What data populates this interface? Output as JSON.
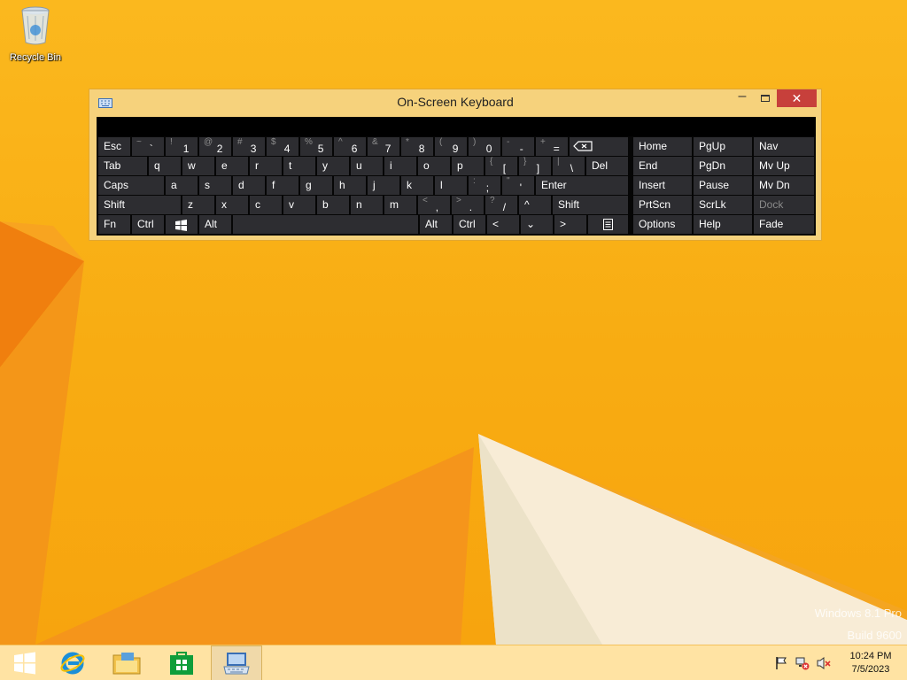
{
  "desktop": {
    "recycle_bin_label": "Recycle Bin",
    "watermark_line1": "Windows 8.1 Pro",
    "watermark_line2": "Build 9600"
  },
  "window": {
    "title": "On-Screen Keyboard",
    "minimize_glyph": "‒",
    "close_glyph": "✕"
  },
  "keys": {
    "esc": "Esc",
    "tilde": {
      "shift": "~",
      "base": "`"
    },
    "n1": {
      "shift": "!",
      "base": "1"
    },
    "n2": {
      "shift": "@",
      "base": "2"
    },
    "n3": {
      "shift": "#",
      "base": "3"
    },
    "n4": {
      "shift": "$",
      "base": "4"
    },
    "n5": {
      "shift": "%",
      "base": "5"
    },
    "n6": {
      "shift": "^",
      "base": "6"
    },
    "n7": {
      "shift": "&",
      "base": "7"
    },
    "n8": {
      "shift": "*",
      "base": "8"
    },
    "n9": {
      "shift": "(",
      "base": "9"
    },
    "n0": {
      "shift": ")",
      "base": "0"
    },
    "minus": {
      "shift": "-",
      "base": "-"
    },
    "plus": {
      "shift": "+",
      "base": "="
    },
    "tab": "Tab",
    "q": "q",
    "w": "w",
    "e": "e",
    "r": "r",
    "t": "t",
    "y": "y",
    "u": "u",
    "i": "i",
    "o": "o",
    "p": "p",
    "lbracket": {
      "shift": "{",
      "base": "["
    },
    "rbracket": {
      "shift": "}",
      "base": "]"
    },
    "pipe": {
      "shift": "|",
      "base": "\\"
    },
    "del": "Del",
    "caps": "Caps",
    "a": "a",
    "s": "s",
    "d": "d",
    "f": "f",
    "g": "g",
    "h": "h",
    "j": "j",
    "k": "k",
    "l": "l",
    "semicolon": {
      "shift": ":",
      "base": ";"
    },
    "quote": {
      "shift": "\"",
      "base": "'"
    },
    "enter": "Enter",
    "shift_left": "Shift",
    "z": "z",
    "x": "x",
    "c": "c",
    "v": "v",
    "b": "b",
    "n": "n",
    "m": "m",
    "comma": {
      "shift": "<",
      "base": ","
    },
    "period": {
      "shift": ">",
      "base": "."
    },
    "slash": {
      "shift": "?",
      "base": "/"
    },
    "up": "^",
    "shift_right": "Shift",
    "fn": "Fn",
    "ctrl_left": "Ctrl",
    "alt_left": "Alt",
    "alt_right": "Alt",
    "ctrl_right": "Ctrl",
    "left": "<",
    "down": "⌄",
    "right": ">",
    "home": "Home",
    "pgup": "PgUp",
    "nav": "Nav",
    "end": "End",
    "pgdn": "PgDn",
    "mvup": "Mv Up",
    "insert": "Insert",
    "pause": "Pause",
    "mvdn": "Mv Dn",
    "prtscn": "PrtScn",
    "scrlk": "ScrLk",
    "dock": "Dock",
    "options": "Options",
    "help": "Help",
    "fade": "Fade"
  },
  "taskbar": {
    "clock_time": "10:24 PM",
    "clock_date": "7/5/2023"
  }
}
